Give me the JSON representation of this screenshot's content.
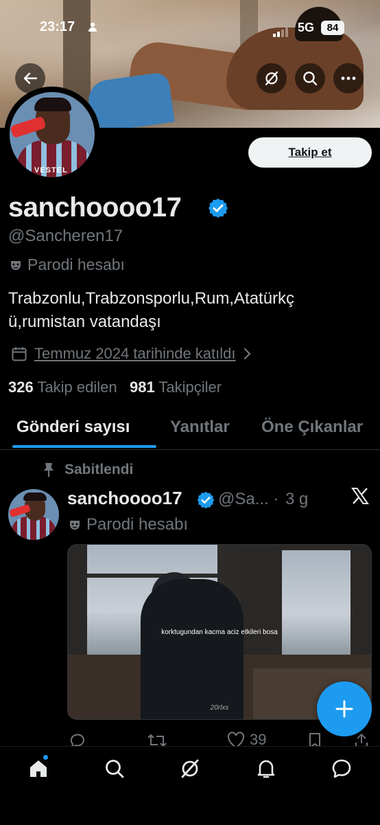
{
  "status_bar": {
    "time": "23:17",
    "network": "5G",
    "battery": "84"
  },
  "header": {
    "follow_label": "Takip et"
  },
  "profile": {
    "display_name": "sanchoooo17",
    "handle": "@Sancheren17",
    "parody_label": "Parodi hesabı",
    "bio_line1": "Trabzonlu,Trabzonsporlu,Rum,Atatürkç",
    "bio_line2": "ü,rumistan vatandaşı",
    "joined": "Temmuz 2024 tarihinde katıldı",
    "following_count": "326",
    "following_label": "Takip edilen",
    "followers_count": "981",
    "followers_label": "Takipçiler"
  },
  "tabs": [
    {
      "label": "Gönderi sayısı",
      "active": true
    },
    {
      "label": "Yanıtlar",
      "active": false
    },
    {
      "label": "Öne Çıkanlar",
      "active": false
    }
  ],
  "post": {
    "pinned_label": "Sabitlendi",
    "author_name": "sanchoooo17",
    "author_handle": "@Sa...",
    "dot": "·",
    "time": "3 g",
    "parody_label": "Parodi hesabı",
    "media_subtitle": "korktugundan kacma aciz etkileri bosa",
    "media_watermark": "20rlxs",
    "like_count": "39"
  },
  "colors": {
    "accent": "#1d9bf0",
    "background": "#000000",
    "secondary_text": "#71767b"
  },
  "icons": [
    "back-arrow-icon",
    "grok-icon",
    "search-icon",
    "more-icon",
    "verified-badge-icon",
    "mask-icon",
    "calendar-icon",
    "chevron-right-icon",
    "pin-icon",
    "x-logo-icon",
    "reply-icon",
    "retweet-icon",
    "like-icon",
    "bookmark-icon",
    "share-icon",
    "plus-icon",
    "home-icon",
    "grok-icon",
    "notifications-icon",
    "messages-icon"
  ]
}
